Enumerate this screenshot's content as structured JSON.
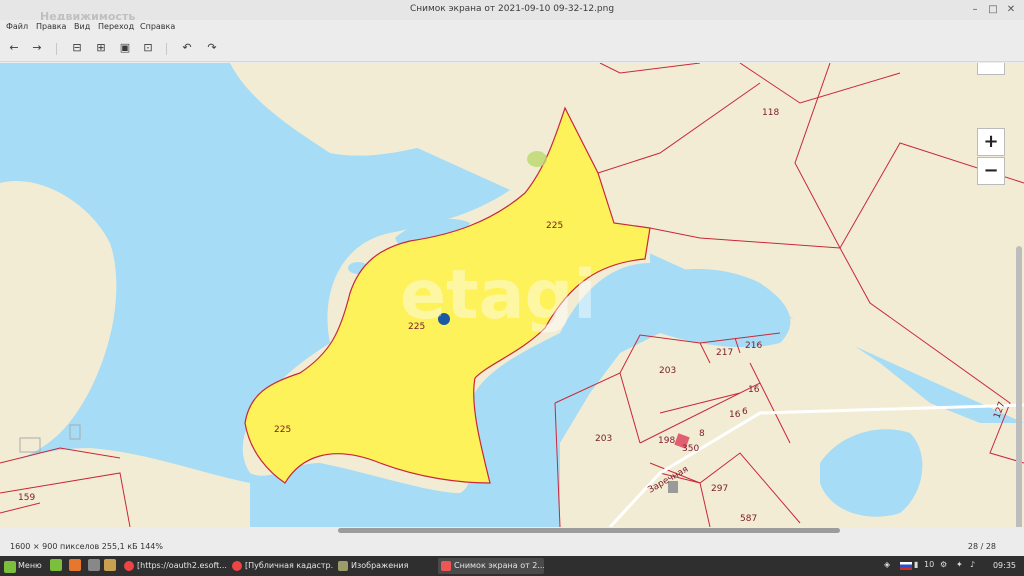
{
  "window": {
    "title": "Снимок экрана от 2021-09-10 09-32-12.png",
    "watermark": "Недвижимость"
  },
  "menu": [
    "Файл",
    "Правка",
    "Вид",
    "Переход",
    "Справка"
  ],
  "toolbar": {
    "icons": [
      "back-icon",
      "forward-icon",
      "zoom-out-icon",
      "zoom-in-icon",
      "zoom-normal-icon",
      "zoom-fit-icon",
      "rotate-left-icon",
      "rotate-right-icon"
    ]
  },
  "map": {
    "watermark": "etagi",
    "zoom_in": "+",
    "zoom_out": "−",
    "labels": {
      "p225a": "225",
      "p225b": "225",
      "p225c": "225",
      "p118": "118",
      "p217": "217",
      "p216": "216",
      "p203a": "203",
      "p203b": "203",
      "p16a": "16",
      "p16b": "16",
      "p6": "6",
      "p198": "198",
      "p8": "8",
      "p350": "350",
      "p297": "297",
      "p587": "587",
      "p127": "127",
      "p159": "159",
      "street": "Заречная"
    },
    "colors": {
      "water": "#a6dcf5",
      "land": "#f3ecd4",
      "highlight": "#fdf25a",
      "border": "#c8283a"
    }
  },
  "status": {
    "info": "1600 × 900 пикселов  255,1 кБ   144%",
    "page": "28 / 28"
  },
  "taskbar": {
    "start": "Меню",
    "tasks": [
      "[https://oauth2.esoft....",
      "[Публичная кадастр...",
      "Изображения",
      "Снимок экрана от 2..."
    ],
    "lang": "10",
    "clock": "09:35"
  }
}
